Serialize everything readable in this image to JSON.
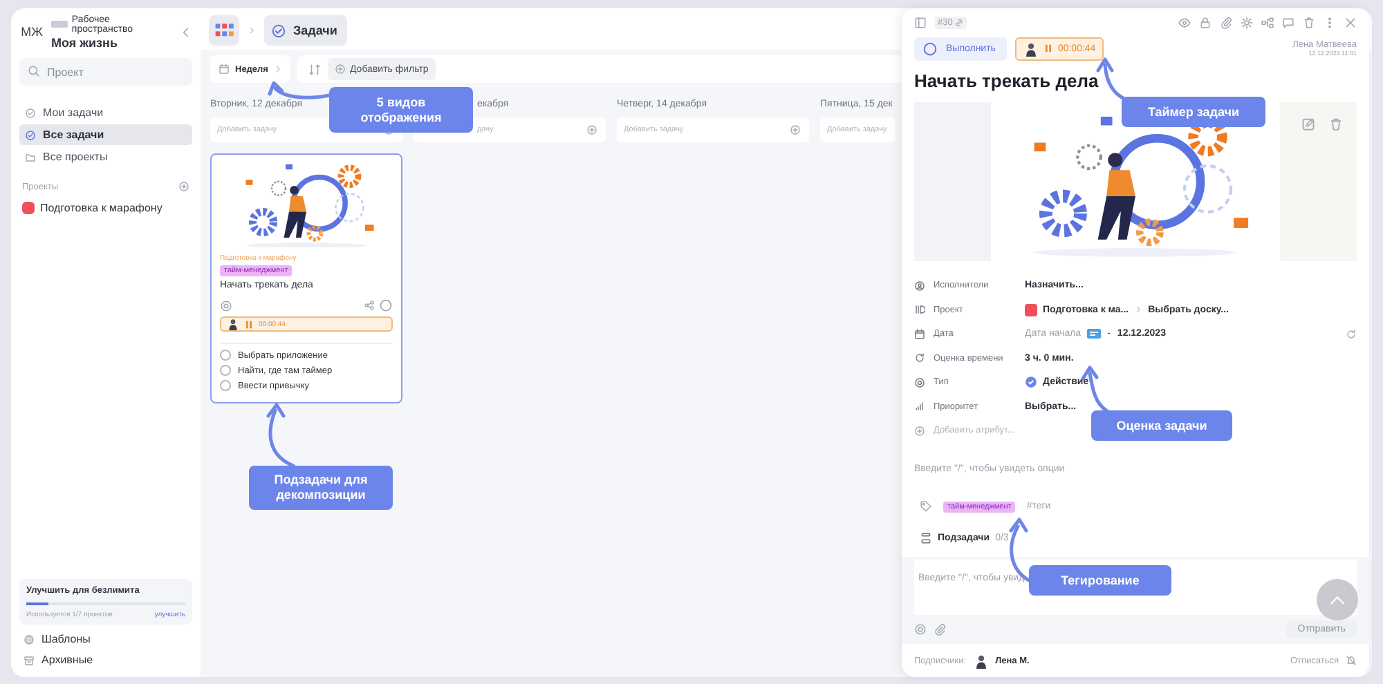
{
  "sidebar": {
    "avatar": "МЖ",
    "workspace_label": "Рабочее пространство",
    "workspace_name": "Моя жизнь",
    "search": {
      "placeholder": "Проект"
    },
    "nav": [
      {
        "label": "Мои задачи",
        "selected": false
      },
      {
        "label": "Все задачи",
        "selected": true
      },
      {
        "label": "Все проекты",
        "selected": false
      }
    ],
    "projects_heading": "Проекты",
    "projects": [
      {
        "label": "Подготовка к марафону",
        "color": "#f0505a"
      }
    ],
    "upgrade": {
      "title": "Улучшить для безлимита",
      "level": 0.14,
      "usage": "Используется 1/7 проектов",
      "link": "улучшить"
    },
    "footer_items": [
      {
        "label": "Шаблоны",
        "kind": "templates"
      },
      {
        "label": "Архивные",
        "kind": "archive"
      }
    ]
  },
  "breadcrumb": {
    "tab": "Задачи"
  },
  "toolbar": {
    "view": "Неделя",
    "filter": "Добавить фильтр"
  },
  "days": [
    {
      "header": "Вторник, 12 декабря",
      "add_placeholder": "Добавить задачу",
      "cards": [
        {
          "project": "Подготовка к марафону",
          "tag": {
            "label": "тайм-менеджмент",
            "color": "#ebb4f7"
          },
          "title": "Начать трекать дела",
          "timer": "00:00:44",
          "subtasks": [
            {
              "label": "Выбрать приложение",
              "checked": false
            },
            {
              "label": "Найти, где там таймер",
              "checked": false
            },
            {
              "label": "Ввести привычку",
              "checked": false
            }
          ]
        }
      ]
    },
    {
      "header": "екабря",
      "add_placeholder": "дачу"
    },
    {
      "header": "Четверг, 14 декабря",
      "add_placeholder": "Добавить задачу"
    },
    {
      "header": "Пятница, 15 дек",
      "add_placeholder": "Добавить задачу"
    }
  ],
  "task_panel": {
    "number": "#30",
    "complete_button": "Выполнить",
    "timer": "00:00:44",
    "author": "Лена Матвеева",
    "created": "12.12.2023 11:01",
    "title": "Начать трекать дела",
    "attributes": [
      {
        "kind": "assignee",
        "label": "Исполнители",
        "value": "Назначить..."
      },
      {
        "kind": "project",
        "label": "Проект",
        "project": "Подготовка к ма...",
        "color": "#f0505a",
        "board": "Выбрать доску..."
      },
      {
        "kind": "date",
        "label": "Дата",
        "start": "Дата начала",
        "separator": "-",
        "end": "12.12.2023"
      },
      {
        "kind": "estimate",
        "label": "Оценка времени",
        "value": "3 ч. 0 мин."
      },
      {
        "kind": "type",
        "label": "Тип",
        "value": "Действие"
      },
      {
        "kind": "priority",
        "label": "Приоритет",
        "value": "Выбрать..."
      }
    ],
    "add_attribute": "Добавить атрибут...",
    "description_placeholder": "Введите \"/\", чтобы увидеть опции",
    "tags": [
      {
        "label": "тайм-менеджмент",
        "color": "#ebb4f7"
      }
    ],
    "tag_placeholder": "#теги",
    "subtasks_label": "Подзадачи",
    "subtasks_count": "0/3",
    "comment_placeholder": "Введите \"/\", чтобы увид",
    "send_button": "Отправить",
    "subscribers_label": "Подписчики:",
    "subscriber": "Лена М.",
    "unsubscribe": "Отписаться"
  },
  "callouts": [
    {
      "text": "5 видов отображения"
    },
    {
      "text": "Подзадачи для декомпозиции"
    },
    {
      "text": "Таймер задачи"
    },
    {
      "text": "Оценка задачи"
    },
    {
      "text": "Тегирование"
    }
  ]
}
